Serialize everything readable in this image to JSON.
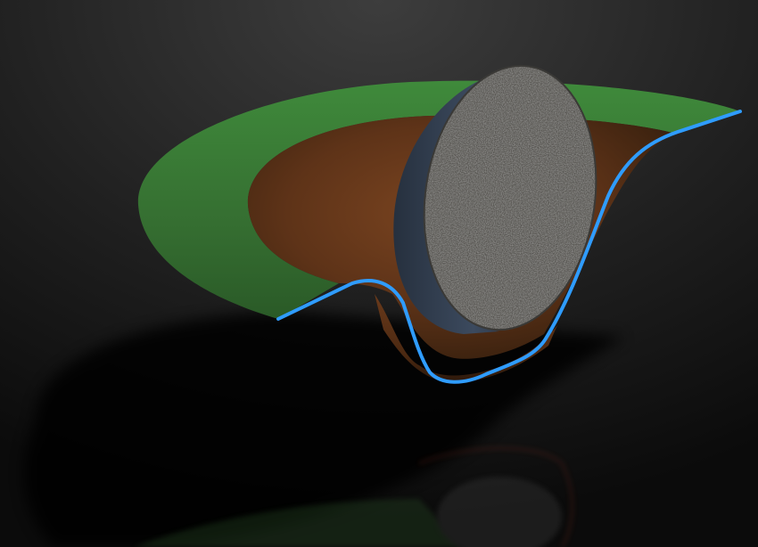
{
  "scene": {
    "subject": "cut-away-hole",
    "colors": {
      "background_top": "#3b3b3b",
      "background_bottom": "#0c0c0c",
      "grass": "#3c7a38",
      "grass_dark": "#2c5a2a",
      "soil": "#6a3a1c",
      "soil_dark": "#3a1d0c",
      "profile_line": "#2f9cff",
      "stone_face": "#5a5855",
      "stone_side": "#2f3c4e"
    }
  }
}
